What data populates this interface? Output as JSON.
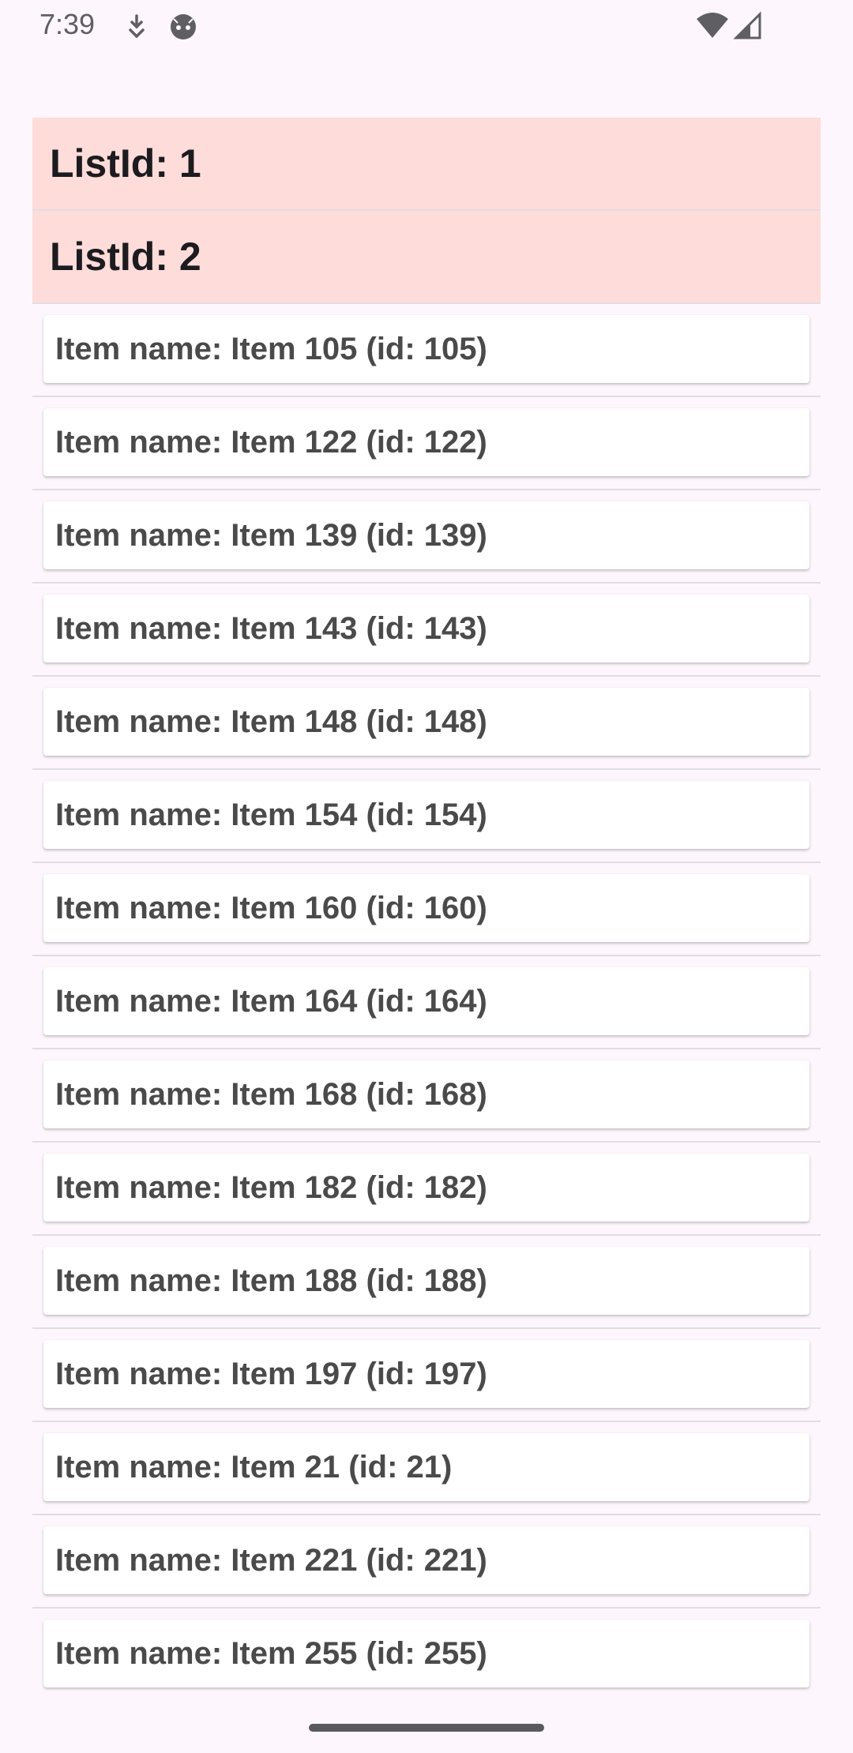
{
  "status_bar": {
    "time": "7:39",
    "icons": [
      "download-icon",
      "app-face-icon",
      "wifi-icon",
      "signal-icon"
    ]
  },
  "colors": {
    "background": "#fdf7fd",
    "header_background": "#fddcda",
    "card_background": "#ffffff",
    "divider": "#e3dce3"
  },
  "list": {
    "headers": [
      {
        "label": "ListId: 1"
      },
      {
        "label": "ListId: 2"
      }
    ],
    "items": [
      {
        "label": "Item name: Item 105 (id: 105)"
      },
      {
        "label": "Item name: Item 122 (id: 122)"
      },
      {
        "label": "Item name: Item 139 (id: 139)"
      },
      {
        "label": "Item name: Item 143 (id: 143)"
      },
      {
        "label": "Item name: Item 148 (id: 148)"
      },
      {
        "label": "Item name: Item 154 (id: 154)"
      },
      {
        "label": "Item name: Item 160 (id: 160)"
      },
      {
        "label": "Item name: Item 164 (id: 164)"
      },
      {
        "label": "Item name: Item 168 (id: 168)"
      },
      {
        "label": "Item name: Item 182 (id: 182)"
      },
      {
        "label": "Item name: Item 188 (id: 188)"
      },
      {
        "label": "Item name: Item 197 (id: 197)"
      },
      {
        "label": "Item name: Item 21 (id: 21)"
      },
      {
        "label": "Item name: Item 221 (id: 221)"
      },
      {
        "label": "Item name: Item 255 (id: 255)"
      }
    ]
  }
}
